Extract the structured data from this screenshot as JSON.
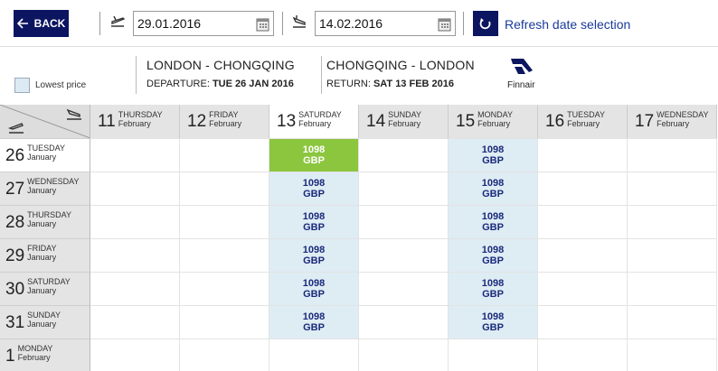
{
  "toolbar": {
    "back_label": "BACK",
    "departure_date": "29.01.2016",
    "return_date": "14.02.2016",
    "refresh_label": "Refresh date selection"
  },
  "legend": {
    "lowest_price_label": "Lowest price"
  },
  "route": {
    "outbound_title": "LONDON - CHONGQING",
    "outbound_label": "DEPARTURE:",
    "outbound_date": "TUE 26 JAN 2016",
    "inbound_title": "CHONGQING - LONDON",
    "inbound_label": "RETURN:",
    "inbound_date": "SAT 13 FEB 2016",
    "airline": "Finnair"
  },
  "colors": {
    "brand_navy": "#0b1560",
    "selected_green": "#8cc63f",
    "available_blue": "#deecf4",
    "price_text": "#1a2a7a"
  },
  "columns": [
    {
      "day": "11",
      "weekday": "THURSDAY",
      "month": "February",
      "selected": false
    },
    {
      "day": "12",
      "weekday": "FRIDAY",
      "month": "February",
      "selected": false
    },
    {
      "day": "13",
      "weekday": "SATURDAY",
      "month": "February",
      "selected": true
    },
    {
      "day": "14",
      "weekday": "SUNDAY",
      "month": "February",
      "selected": false
    },
    {
      "day": "15",
      "weekday": "MONDAY",
      "month": "February",
      "selected": false
    },
    {
      "day": "16",
      "weekday": "TUESDAY",
      "month": "February",
      "selected": false
    },
    {
      "day": "17",
      "weekday": "WEDNESDAY",
      "month": "February",
      "selected": false
    }
  ],
  "rows": [
    {
      "day": "26",
      "weekday": "TUESDAY",
      "month": "January",
      "selected": true
    },
    {
      "day": "27",
      "weekday": "WEDNESDAY",
      "month": "January",
      "selected": false
    },
    {
      "day": "28",
      "weekday": "THURSDAY",
      "month": "January",
      "selected": false
    },
    {
      "day": "29",
      "weekday": "FRIDAY",
      "month": "January",
      "selected": false
    },
    {
      "day": "30",
      "weekday": "SATURDAY",
      "month": "January",
      "selected": false
    },
    {
      "day": "31",
      "weekday": "SUNDAY",
      "month": "January",
      "selected": false
    },
    {
      "day": "1",
      "weekday": "MONDAY",
      "month": "February",
      "selected": false
    }
  ],
  "fares": [
    {
      "row": 0,
      "col": 2,
      "price": "1098",
      "currency": "GBP",
      "chosen": true
    },
    {
      "row": 0,
      "col": 4,
      "price": "1098",
      "currency": "GBP",
      "chosen": false
    },
    {
      "row": 1,
      "col": 2,
      "price": "1098",
      "currency": "GBP",
      "chosen": false
    },
    {
      "row": 1,
      "col": 4,
      "price": "1098",
      "currency": "GBP",
      "chosen": false
    },
    {
      "row": 2,
      "col": 2,
      "price": "1098",
      "currency": "GBP",
      "chosen": false
    },
    {
      "row": 2,
      "col": 4,
      "price": "1098",
      "currency": "GBP",
      "chosen": false
    },
    {
      "row": 3,
      "col": 2,
      "price": "1098",
      "currency": "GBP",
      "chosen": false
    },
    {
      "row": 3,
      "col": 4,
      "price": "1098",
      "currency": "GBP",
      "chosen": false
    },
    {
      "row": 4,
      "col": 2,
      "price": "1098",
      "currency": "GBP",
      "chosen": false
    },
    {
      "row": 4,
      "col": 4,
      "price": "1098",
      "currency": "GBP",
      "chosen": false
    },
    {
      "row": 5,
      "col": 2,
      "price": "1098",
      "currency": "GBP",
      "chosen": false
    },
    {
      "row": 5,
      "col": 4,
      "price": "1098",
      "currency": "GBP",
      "chosen": false
    }
  ]
}
